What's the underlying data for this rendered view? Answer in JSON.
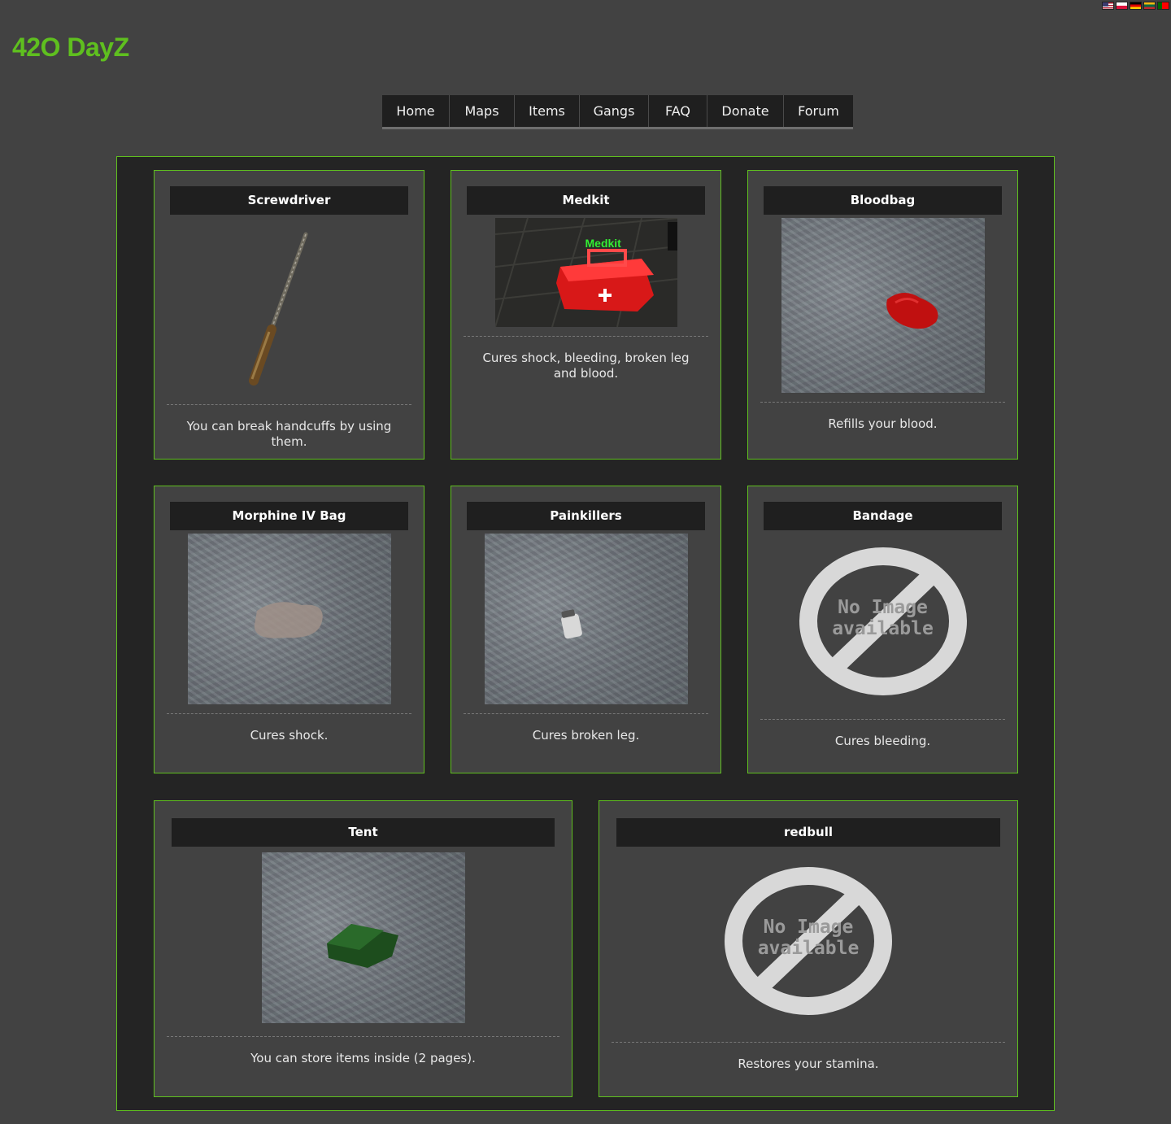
{
  "site": {
    "title": "42O DayZ"
  },
  "flags": [
    "us",
    "pl",
    "de",
    "lt",
    "pt"
  ],
  "nav": {
    "items": [
      {
        "label": "Home"
      },
      {
        "label": "Maps"
      },
      {
        "label": "Items"
      },
      {
        "label": "Gangs"
      },
      {
        "label": "FAQ"
      },
      {
        "label": "Donate"
      },
      {
        "label": "Forum"
      }
    ]
  },
  "items": [
    {
      "title": "Screwdriver",
      "image": "screwdriver",
      "description": "You can break handcuffs by using them."
    },
    {
      "title": "Medkit",
      "image": "medkit",
      "image_label": "Medkit",
      "description": "Cures shock, bleeding, broken leg and blood."
    },
    {
      "title": "Bloodbag",
      "image": "bloodbag",
      "description": "Refills your blood."
    },
    {
      "title": "Morphine IV Bag",
      "image": "morphine-iv-bag",
      "description": "Cures shock."
    },
    {
      "title": "Painkillers",
      "image": "painkillers",
      "description": "Cures broken leg."
    },
    {
      "title": "Bandage",
      "image": "no-image",
      "image_label": "No Image available",
      "description": "Cures bleeding."
    },
    {
      "title": "Tent",
      "image": "tent",
      "description": "You can store items inside (2 pages)."
    },
    {
      "title": "redbull",
      "image": "no-image",
      "image_label": "No Image available",
      "description": "Restores your stamina."
    }
  ],
  "colors": {
    "accent": "#5fbf1f",
    "background": "#424242",
    "panel": "#242424",
    "title_bar": "#1f1f1f"
  }
}
